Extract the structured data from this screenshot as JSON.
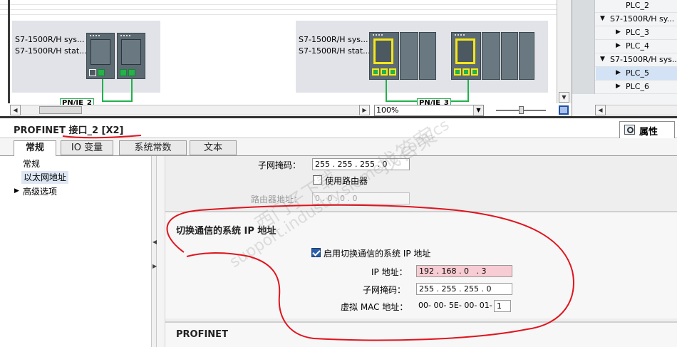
{
  "network_view": {
    "left_station": {
      "title": "S7-1500R/H sys...",
      "subtitle": "S7-1500R/H  stat..."
    },
    "right_station": {
      "title": "S7-1500R/H sys...",
      "subtitle": "S7-1500R/H  stat..."
    },
    "link_left": "PN/IE_2",
    "link_right": "PN/IE_3",
    "zoom": "100%"
  },
  "project_tree": {
    "items": [
      {
        "label": "PLC_2",
        "level": 2,
        "expand": ""
      },
      {
        "label": "S7-1500R/H sy...",
        "level": 1,
        "expand": "down"
      },
      {
        "label": "PLC_3",
        "level": 2,
        "expand": "right"
      },
      {
        "label": "PLC_4",
        "level": 2,
        "expand": "right"
      },
      {
        "label": "S7-1500R/H sys...",
        "level": 1,
        "expand": "down"
      },
      {
        "label": "PLC_5",
        "level": 2,
        "expand": "right",
        "selected": true
      },
      {
        "label": "PLC_6",
        "level": 2,
        "expand": "right"
      }
    ]
  },
  "inspector": {
    "title": "PROFINET 接口_2 [X2]",
    "properties_tab": "属性",
    "tabs": [
      "常规",
      "IO 变量",
      "系统常数",
      "文本"
    ],
    "nav": {
      "items": [
        "常规",
        "以太网地址",
        "高级选项"
      ]
    },
    "subnet_mask_label": "子网掩码：",
    "subnet_mask_value": "255 . 255 . 255 . 0",
    "use_router_label": "使用路由器",
    "router_address_label": "路由器地址：",
    "router_address_value": "0 . 0 . 0 . 0",
    "switch_section": {
      "title": "切换通信的系统 IP 地址",
      "enable_label": "启用切换通信的系统 IP 地址",
      "ip_label": "IP 地址：",
      "ip_value": "192 . 168 . 0   . 3",
      "mask_label": "子网掩码：",
      "mask_value": "255 . 255 . 255 . 0",
      "mac_label": "虚拟 MAC 地址：",
      "mac_prefix": "00- 00- 5E- 00- 01-",
      "mac_value": "1"
    },
    "profinet_section_title": "PROFINET"
  },
  "overlays": {
    "watermark": [
      "support.industry.siemens.com/cs",
      "西门子下载",
      "找答案"
    ]
  },
  "colors": {
    "link_green": "#22b14c",
    "highlight_yellow": "#f5e61b",
    "annotation_red": "#e0141e",
    "pink_field": "#f8ccd3"
  }
}
